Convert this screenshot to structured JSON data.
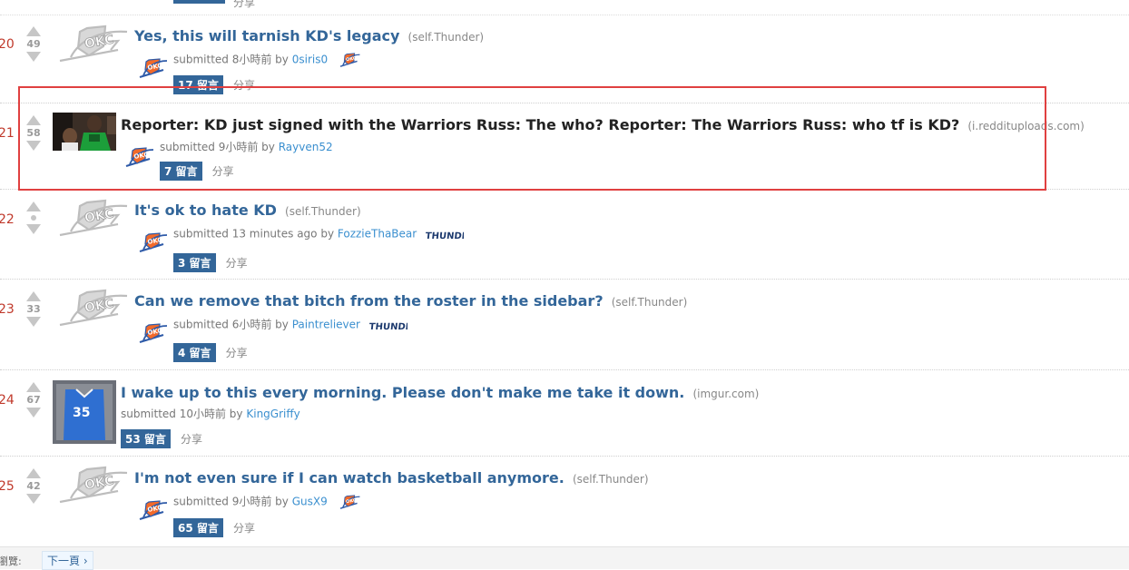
{
  "listing": {
    "prev_row": {
      "share_label": "分享"
    },
    "posts": [
      {
        "rank": "20",
        "score": "49",
        "title": "Yes, this will tarnish KD's legacy",
        "domain": "(self.Thunder)",
        "submitted": "submitted 8小時前 by",
        "author": "0siris0",
        "author_flair": "okc-logo-icon",
        "comments_label": "17 留言",
        "share_label": "分享",
        "thumbnail": "okc-logo-icon"
      },
      {
        "rank": "21",
        "score": "58",
        "title": "Reporter: KD just signed with the Warriors Russ: The who? Reporter: The Warriors Russ: who tf is KD?",
        "domain": "(i.reddituploads.com)",
        "submitted": "submitted 9小時前 by",
        "author": "Rayven52",
        "author_flair": "",
        "comments_label": "7 留言",
        "share_label": "分享",
        "thumbnail": "photo-thumbnail",
        "highlighted": true
      },
      {
        "rank": "22",
        "score": "",
        "title": "It's ok to hate KD",
        "domain": "(self.Thunder)",
        "submitted": "submitted 13 minutes ago by",
        "author": "FozzieThaBear",
        "author_flair": "thunder-wordmark-icon",
        "comments_label": "3 留言",
        "share_label": "分享",
        "thumbnail": "okc-logo-icon"
      },
      {
        "rank": "23",
        "score": "33",
        "title": "Can we remove that bitch from the roster in the sidebar?",
        "domain": "(self.Thunder)",
        "submitted": "submitted 6小時前 by",
        "author": "Paintreliever",
        "author_flair": "thunder-wordmark-icon",
        "comments_label": "4 留言",
        "share_label": "分享",
        "thumbnail": "okc-logo-icon"
      },
      {
        "rank": "24",
        "score": "67",
        "title": "I wake up to this every morning. Please don't make me take it down.",
        "domain": "(imgur.com)",
        "submitted": "submitted 10小時前 by",
        "author": "KingGriffy",
        "author_flair": "",
        "comments_label": "53 留言",
        "share_label": "分享",
        "thumbnail": "jersey-thumbnail"
      },
      {
        "rank": "25",
        "score": "42",
        "title": "I'm not even sure if I can watch basketball anymore.",
        "domain": "(self.Thunder)",
        "submitted": "submitted 9小時前 by",
        "author": "GusX9",
        "author_flair": "okc-logo-icon",
        "comments_label": "65 留言",
        "share_label": "分享",
        "thumbnail": "okc-logo-icon"
      }
    ]
  },
  "jersey_number": "35",
  "flair_text": "THUNDER",
  "footer": {
    "label": "瀏覽:",
    "next_label": "下一頁 ›"
  },
  "colors": {
    "title": "#336699",
    "button": "#336699",
    "highlight_border": "#e04040",
    "rank": "#c0392b",
    "user": "#3a8fcf"
  }
}
